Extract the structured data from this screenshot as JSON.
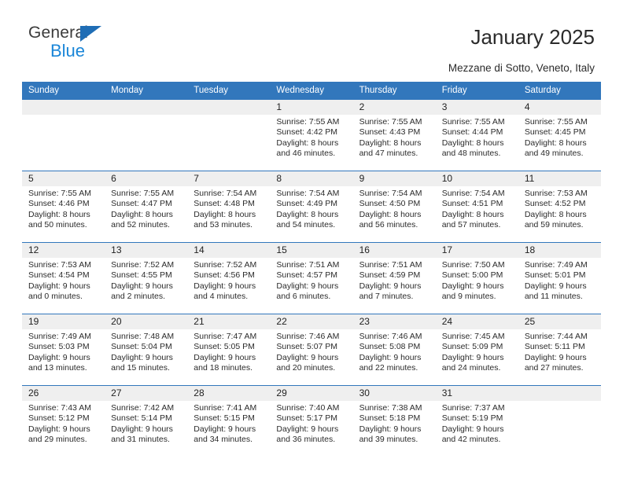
{
  "brand": {
    "name_top": "General",
    "name_bottom": "Blue",
    "accent_color": "#1a86d8",
    "triangle_color": "#1f6db5"
  },
  "header": {
    "title": "January 2025",
    "subtitle": "Mezzane di Sotto, Veneto, Italy",
    "header_bg": "#3277bc",
    "daynum_bg": "#efefef"
  },
  "weekdays": [
    "Sunday",
    "Monday",
    "Tuesday",
    "Wednesday",
    "Thursday",
    "Friday",
    "Saturday"
  ],
  "labels": {
    "sunrise": "Sunrise:",
    "sunset": "Sunset:",
    "daylight": "Daylight:"
  },
  "weeks": [
    [
      {
        "day": "",
        "sunrise": "",
        "sunset": "",
        "daylight1": "",
        "daylight2": ""
      },
      {
        "day": "",
        "sunrise": "",
        "sunset": "",
        "daylight1": "",
        "daylight2": ""
      },
      {
        "day": "",
        "sunrise": "",
        "sunset": "",
        "daylight1": "",
        "daylight2": ""
      },
      {
        "day": "1",
        "sunrise": "Sunrise: 7:55 AM",
        "sunset": "Sunset: 4:42 PM",
        "daylight1": "Daylight: 8 hours",
        "daylight2": "and 46 minutes."
      },
      {
        "day": "2",
        "sunrise": "Sunrise: 7:55 AM",
        "sunset": "Sunset: 4:43 PM",
        "daylight1": "Daylight: 8 hours",
        "daylight2": "and 47 minutes."
      },
      {
        "day": "3",
        "sunrise": "Sunrise: 7:55 AM",
        "sunset": "Sunset: 4:44 PM",
        "daylight1": "Daylight: 8 hours",
        "daylight2": "and 48 minutes."
      },
      {
        "day": "4",
        "sunrise": "Sunrise: 7:55 AM",
        "sunset": "Sunset: 4:45 PM",
        "daylight1": "Daylight: 8 hours",
        "daylight2": "and 49 minutes."
      }
    ],
    [
      {
        "day": "5",
        "sunrise": "Sunrise: 7:55 AM",
        "sunset": "Sunset: 4:46 PM",
        "daylight1": "Daylight: 8 hours",
        "daylight2": "and 50 minutes."
      },
      {
        "day": "6",
        "sunrise": "Sunrise: 7:55 AM",
        "sunset": "Sunset: 4:47 PM",
        "daylight1": "Daylight: 8 hours",
        "daylight2": "and 52 minutes."
      },
      {
        "day": "7",
        "sunrise": "Sunrise: 7:54 AM",
        "sunset": "Sunset: 4:48 PM",
        "daylight1": "Daylight: 8 hours",
        "daylight2": "and 53 minutes."
      },
      {
        "day": "8",
        "sunrise": "Sunrise: 7:54 AM",
        "sunset": "Sunset: 4:49 PM",
        "daylight1": "Daylight: 8 hours",
        "daylight2": "and 54 minutes."
      },
      {
        "day": "9",
        "sunrise": "Sunrise: 7:54 AM",
        "sunset": "Sunset: 4:50 PM",
        "daylight1": "Daylight: 8 hours",
        "daylight2": "and 56 minutes."
      },
      {
        "day": "10",
        "sunrise": "Sunrise: 7:54 AM",
        "sunset": "Sunset: 4:51 PM",
        "daylight1": "Daylight: 8 hours",
        "daylight2": "and 57 minutes."
      },
      {
        "day": "11",
        "sunrise": "Sunrise: 7:53 AM",
        "sunset": "Sunset: 4:52 PM",
        "daylight1": "Daylight: 8 hours",
        "daylight2": "and 59 minutes."
      }
    ],
    [
      {
        "day": "12",
        "sunrise": "Sunrise: 7:53 AM",
        "sunset": "Sunset: 4:54 PM",
        "daylight1": "Daylight: 9 hours",
        "daylight2": "and 0 minutes."
      },
      {
        "day": "13",
        "sunrise": "Sunrise: 7:52 AM",
        "sunset": "Sunset: 4:55 PM",
        "daylight1": "Daylight: 9 hours",
        "daylight2": "and 2 minutes."
      },
      {
        "day": "14",
        "sunrise": "Sunrise: 7:52 AM",
        "sunset": "Sunset: 4:56 PM",
        "daylight1": "Daylight: 9 hours",
        "daylight2": "and 4 minutes."
      },
      {
        "day": "15",
        "sunrise": "Sunrise: 7:51 AM",
        "sunset": "Sunset: 4:57 PM",
        "daylight1": "Daylight: 9 hours",
        "daylight2": "and 6 minutes."
      },
      {
        "day": "16",
        "sunrise": "Sunrise: 7:51 AM",
        "sunset": "Sunset: 4:59 PM",
        "daylight1": "Daylight: 9 hours",
        "daylight2": "and 7 minutes."
      },
      {
        "day": "17",
        "sunrise": "Sunrise: 7:50 AM",
        "sunset": "Sunset: 5:00 PM",
        "daylight1": "Daylight: 9 hours",
        "daylight2": "and 9 minutes."
      },
      {
        "day": "18",
        "sunrise": "Sunrise: 7:49 AM",
        "sunset": "Sunset: 5:01 PM",
        "daylight1": "Daylight: 9 hours",
        "daylight2": "and 11 minutes."
      }
    ],
    [
      {
        "day": "19",
        "sunrise": "Sunrise: 7:49 AM",
        "sunset": "Sunset: 5:03 PM",
        "daylight1": "Daylight: 9 hours",
        "daylight2": "and 13 minutes."
      },
      {
        "day": "20",
        "sunrise": "Sunrise: 7:48 AM",
        "sunset": "Sunset: 5:04 PM",
        "daylight1": "Daylight: 9 hours",
        "daylight2": "and 15 minutes."
      },
      {
        "day": "21",
        "sunrise": "Sunrise: 7:47 AM",
        "sunset": "Sunset: 5:05 PM",
        "daylight1": "Daylight: 9 hours",
        "daylight2": "and 18 minutes."
      },
      {
        "day": "22",
        "sunrise": "Sunrise: 7:46 AM",
        "sunset": "Sunset: 5:07 PM",
        "daylight1": "Daylight: 9 hours",
        "daylight2": "and 20 minutes."
      },
      {
        "day": "23",
        "sunrise": "Sunrise: 7:46 AM",
        "sunset": "Sunset: 5:08 PM",
        "daylight1": "Daylight: 9 hours",
        "daylight2": "and 22 minutes."
      },
      {
        "day": "24",
        "sunrise": "Sunrise: 7:45 AM",
        "sunset": "Sunset: 5:09 PM",
        "daylight1": "Daylight: 9 hours",
        "daylight2": "and 24 minutes."
      },
      {
        "day": "25",
        "sunrise": "Sunrise: 7:44 AM",
        "sunset": "Sunset: 5:11 PM",
        "daylight1": "Daylight: 9 hours",
        "daylight2": "and 27 minutes."
      }
    ],
    [
      {
        "day": "26",
        "sunrise": "Sunrise: 7:43 AM",
        "sunset": "Sunset: 5:12 PM",
        "daylight1": "Daylight: 9 hours",
        "daylight2": "and 29 minutes."
      },
      {
        "day": "27",
        "sunrise": "Sunrise: 7:42 AM",
        "sunset": "Sunset: 5:14 PM",
        "daylight1": "Daylight: 9 hours",
        "daylight2": "and 31 minutes."
      },
      {
        "day": "28",
        "sunrise": "Sunrise: 7:41 AM",
        "sunset": "Sunset: 5:15 PM",
        "daylight1": "Daylight: 9 hours",
        "daylight2": "and 34 minutes."
      },
      {
        "day": "29",
        "sunrise": "Sunrise: 7:40 AM",
        "sunset": "Sunset: 5:17 PM",
        "daylight1": "Daylight: 9 hours",
        "daylight2": "and 36 minutes."
      },
      {
        "day": "30",
        "sunrise": "Sunrise: 7:38 AM",
        "sunset": "Sunset: 5:18 PM",
        "daylight1": "Daylight: 9 hours",
        "daylight2": "and 39 minutes."
      },
      {
        "day": "31",
        "sunrise": "Sunrise: 7:37 AM",
        "sunset": "Sunset: 5:19 PM",
        "daylight1": "Daylight: 9 hours",
        "daylight2": "and 42 minutes."
      },
      {
        "day": "",
        "sunrise": "",
        "sunset": "",
        "daylight1": "",
        "daylight2": ""
      }
    ]
  ]
}
